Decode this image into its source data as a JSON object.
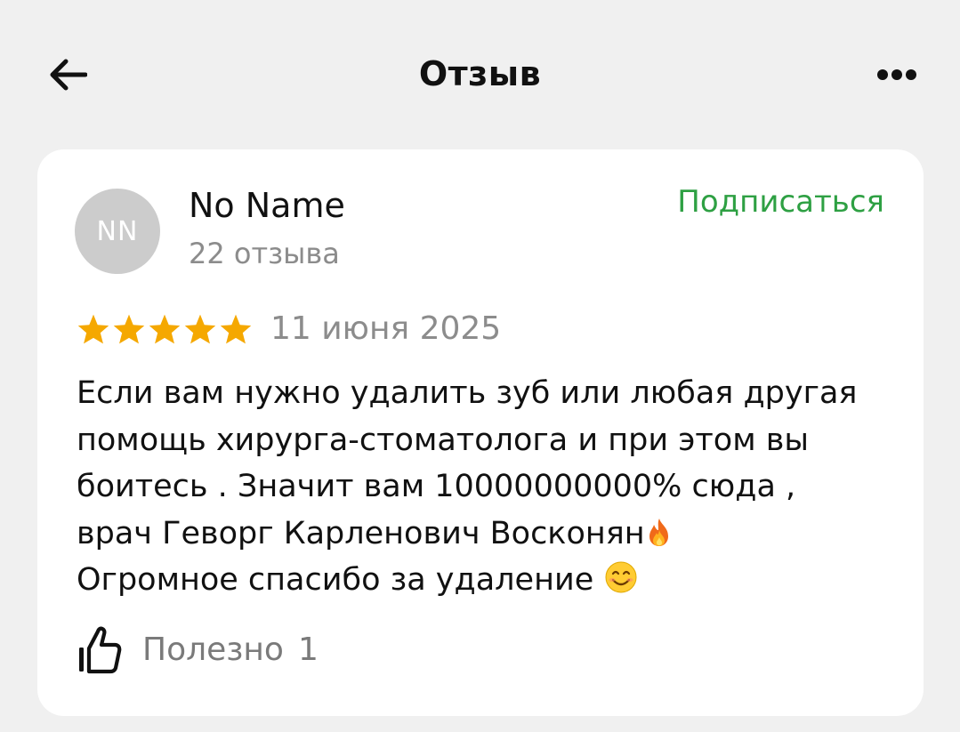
{
  "header": {
    "title": "Отзыв",
    "back_icon": "arrow-left-icon",
    "more_icon": "more-horizontal-icon"
  },
  "review": {
    "author": {
      "initials": "NN",
      "name": "No Name",
      "reviews_count": "22 отзыва"
    },
    "subscribe_label": "Подписаться",
    "rating": 5,
    "rating_max": 5,
    "date": "11 июня 2025",
    "lines": [
      "Если вам нужно удалить зуб или любая другая",
      "помощь хирурга-стоматолога и при этом вы",
      "боитесь . Значит вам 10000000000% сюда ,",
      "врач Геворг Карленович Восконян",
      "Огромное спасибо за удаление"
    ],
    "line4_emoji": "fire-emoji",
    "line5_emoji": "smiling-face-emoji",
    "useful": {
      "icon": "thumbs-up-icon",
      "label": "Полезно",
      "count": "1"
    }
  },
  "colors": {
    "background": "#f0f0f0",
    "card": "#ffffff",
    "accent_green": "#2ea043",
    "star": "#f5a800",
    "muted_text": "#8c8c8c",
    "avatar_bg": "#cccccc"
  }
}
